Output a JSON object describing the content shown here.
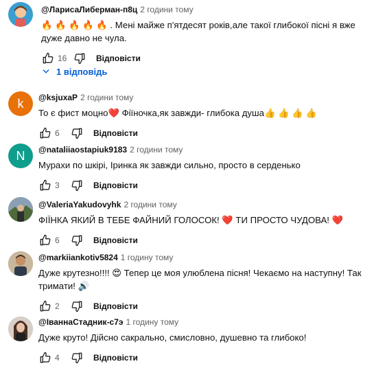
{
  "comments": [
    {
      "author": "@ЛарисаЛиберман-п8ц",
      "time": "2 години тому",
      "text": "🔥 🔥 🔥 🔥 🔥 . Мені майже п'ятдесят років,але такої глибокої пісні я вже дуже давно не чула.",
      "likes": "16",
      "reply_label": "Відповісти",
      "avatar_style": "cartoon",
      "avatar_bg": "#3a9fd0"
    },
    {
      "author": "@ksjuxaP",
      "time": "2 години тому",
      "text": "То є фист моцно❤️ Фіїночка,як завжди- глибока душа👍 👍 👍 👍",
      "likes": "6",
      "reply_label": "Відповісти",
      "avatar_style": "letter",
      "avatar_letter": "k",
      "avatar_bg": "#e8710a"
    },
    {
      "author": "@nataliiaostapiuk9183",
      "time": "2 години тому",
      "text": "Мурахи по шкірі, Іринка як завжди сильно, просто в серденько",
      "likes": "3",
      "reply_label": "Відповісти",
      "avatar_style": "letter",
      "avatar_letter": "N",
      "avatar_bg": "#0f9d8c"
    },
    {
      "author": "@ValeriaYakudovyhk",
      "time": "2 години тому",
      "text": "ФІЇНКА ЯКИЙ В ТЕБЕ ФАЙНИЙ ГОЛОСОК! ❤️ ТИ ПРОСТО ЧУДОВА! ❤️",
      "likes": "6",
      "reply_label": "Відповісти",
      "avatar_style": "photo",
      "avatar_bg": "#6f7d5a"
    },
    {
      "author": "@markiiankotiv5824",
      "time": "1 годину тому",
      "text": "Дуже крутезно!!!! 😍 Тепер це моя улюблена пісня! Чекаємо на наступну! Так тримати! 🔊",
      "likes": "2",
      "reply_label": "Відповісти",
      "avatar_style": "photo",
      "avatar_bg": "#8a6b4e"
    },
    {
      "author": "@IваннаСтадник-с7э",
      "time": "1 годину тому",
      "text": "Дуже круто! Дійсно сакрально, смисловно, душевно та глибоко!",
      "likes": "4",
      "reply_label": "Відповісти",
      "avatar_style": "photo",
      "avatar_bg": "#b89a8c"
    }
  ],
  "replies_toggle": {
    "label": "1 відповідь",
    "color": "#065fd4"
  },
  "icons": {
    "like": "thumb-up-icon",
    "dislike": "thumb-down-icon",
    "expand": "chevron-down-icon"
  }
}
